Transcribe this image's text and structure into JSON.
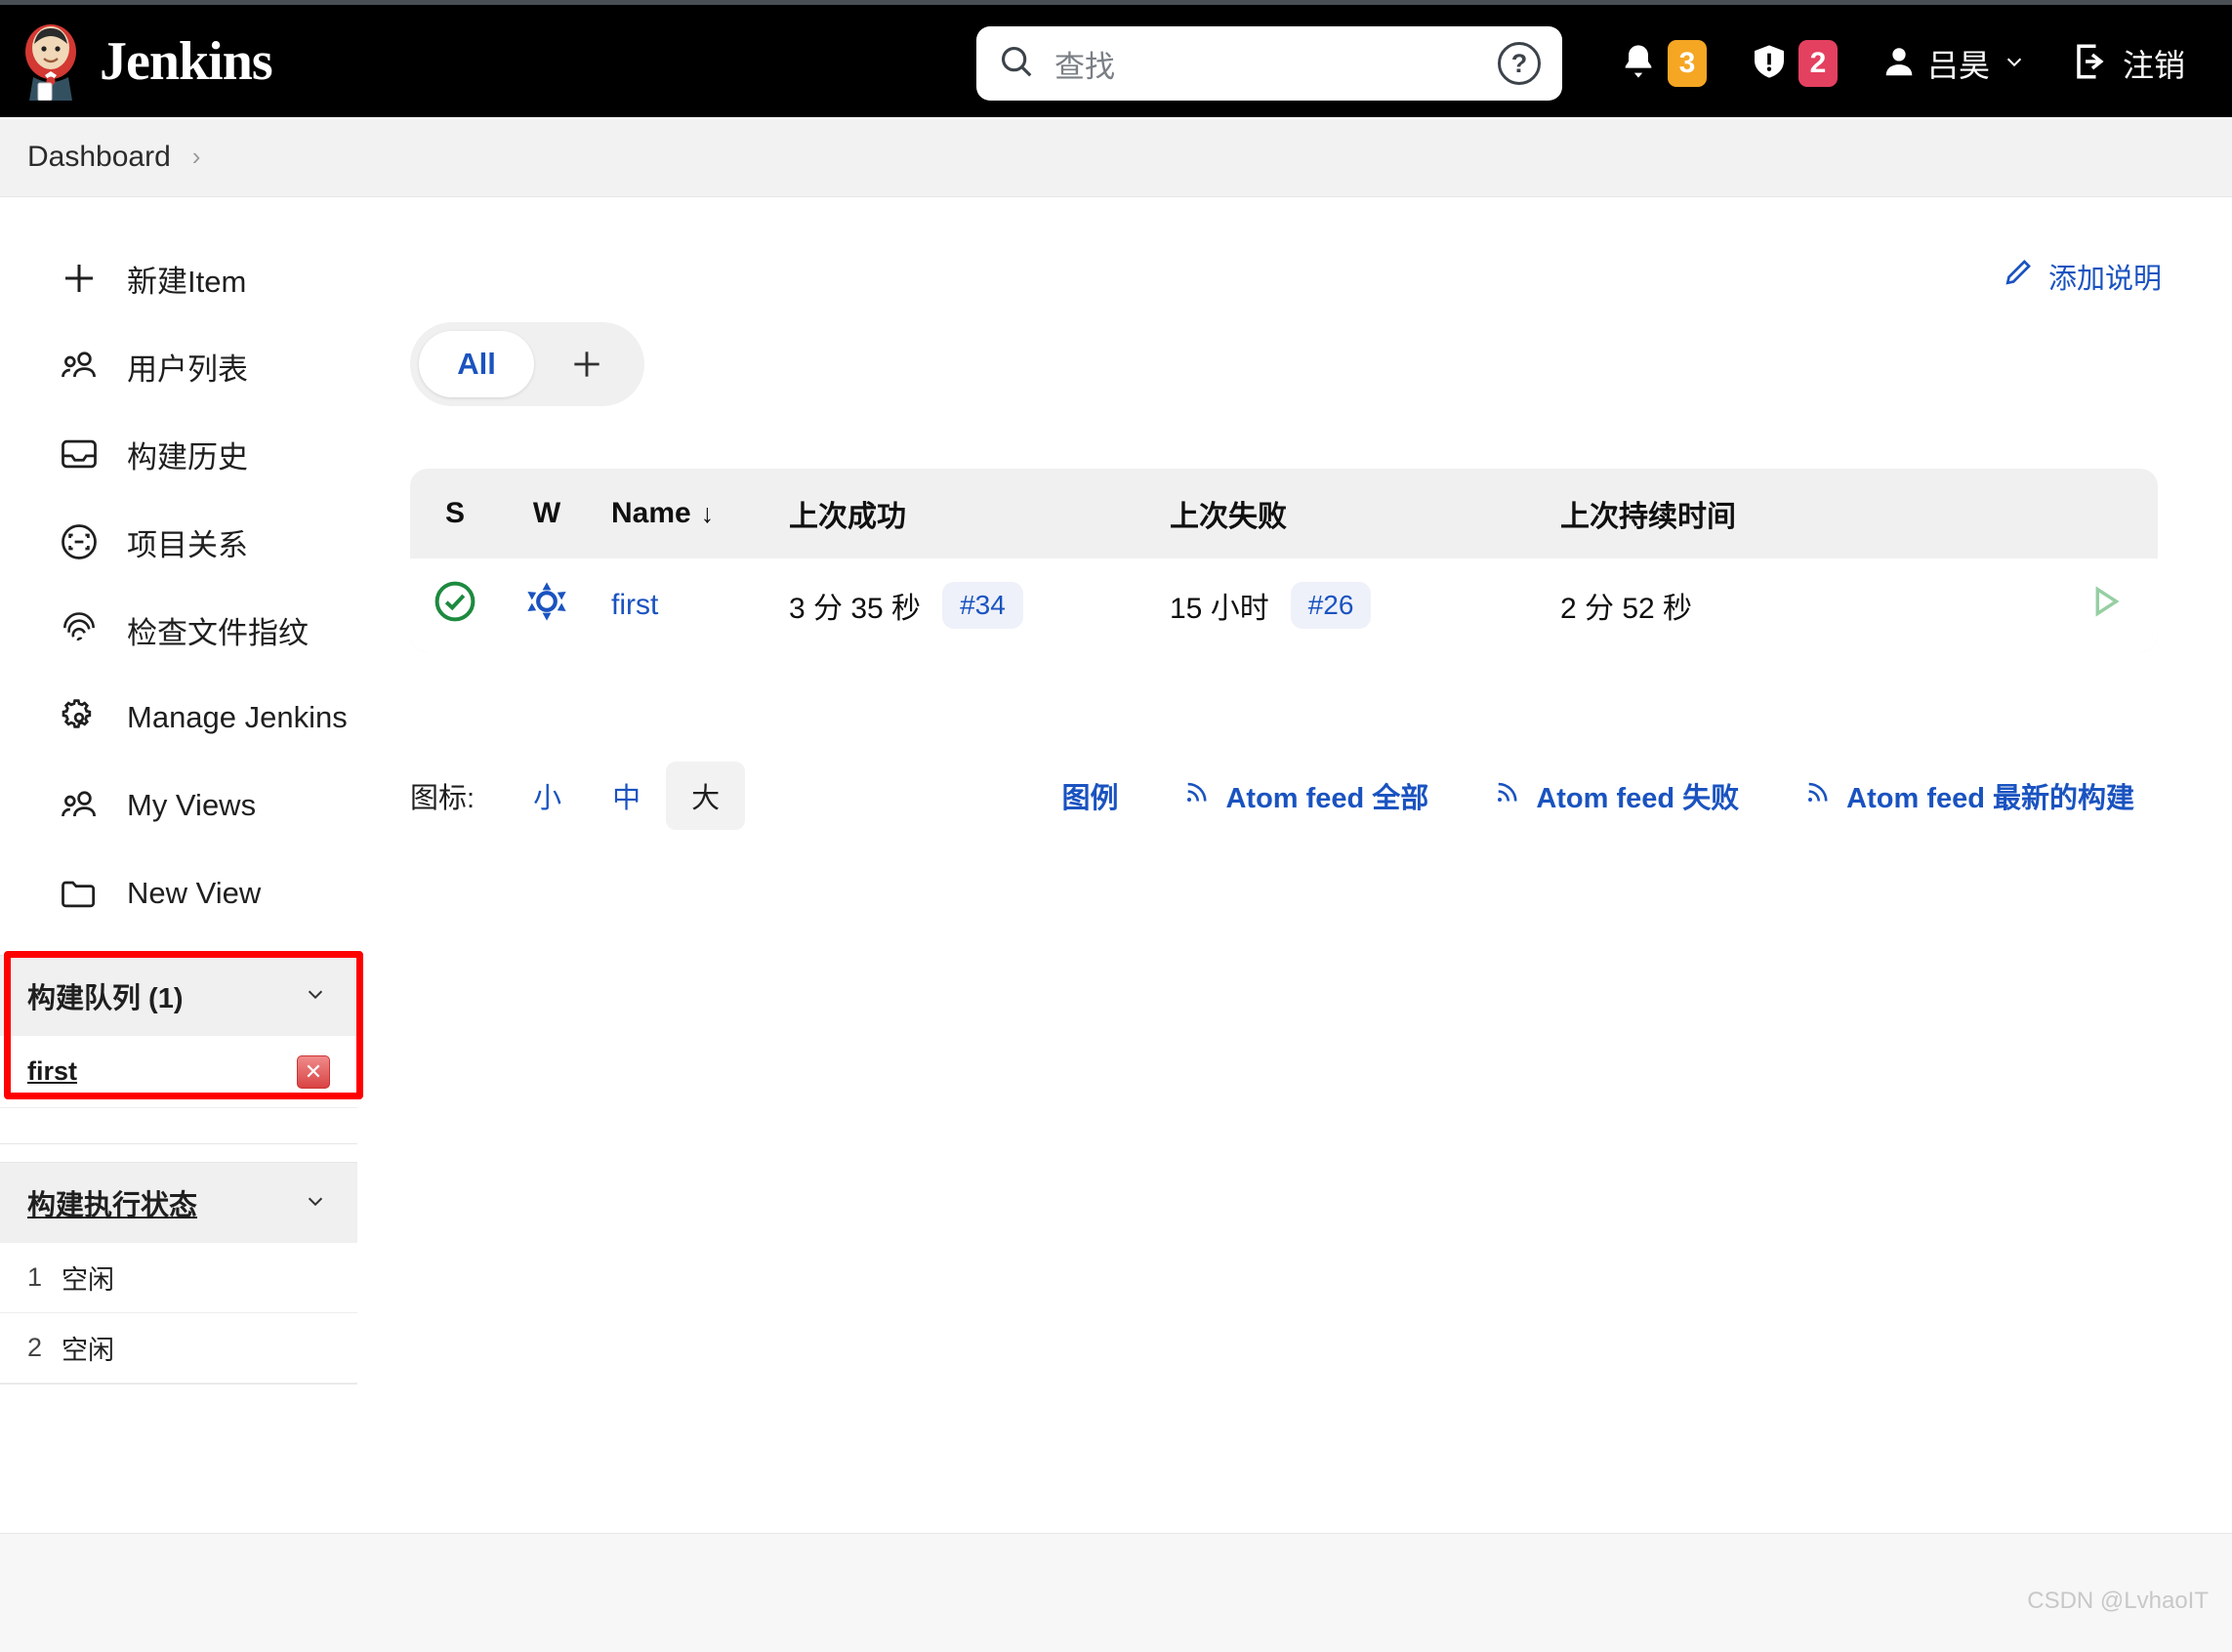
{
  "header": {
    "brand": "Jenkins",
    "search": {
      "placeholder": "查找",
      "help_icon": "help-circle-icon"
    },
    "notifications": {
      "icon": "bell-icon",
      "count": "3",
      "color": "#f5a623"
    },
    "security": {
      "icon": "shield-alert-icon",
      "count": "2",
      "color": "#e4405f"
    },
    "user": {
      "icon": "person-icon",
      "name": "吕昊",
      "chevron": "chevron-down-icon"
    },
    "logout": {
      "icon": "logout-icon",
      "label": "注销"
    }
  },
  "breadcrumb": {
    "items": [
      "Dashboard"
    ],
    "separator": "›"
  },
  "sidebar": {
    "items": [
      {
        "label": "新建Item",
        "icon": "plus-icon"
      },
      {
        "label": "用户列表",
        "icon": "people-icon"
      },
      {
        "label": "构建历史",
        "icon": "inbox-icon"
      },
      {
        "label": "项目关系",
        "icon": "relations-icon"
      },
      {
        "label": "检查文件指纹",
        "icon": "fingerprint-icon"
      },
      {
        "label": "Manage Jenkins",
        "icon": "gear-icon"
      },
      {
        "label": "My Views",
        "icon": "people-icon"
      },
      {
        "label": "New View",
        "icon": "folder-icon"
      }
    ],
    "build_queue": {
      "title": "构建队列 (1)",
      "chevron": "chevron-down-icon",
      "items": [
        {
          "name": "first",
          "cancel_icon": "close-icon"
        }
      ]
    },
    "executor_status": {
      "title": "构建执行状态",
      "chevron": "chevron-down-icon",
      "executors": [
        {
          "num": "1",
          "status": "空闲"
        },
        {
          "num": "2",
          "status": "空闲"
        }
      ]
    }
  },
  "main": {
    "add_description": {
      "label": "添加说明",
      "icon": "pencil-icon"
    },
    "tabs": [
      {
        "label": "All",
        "active": true
      }
    ],
    "tab_add": {
      "icon": "plus-icon"
    },
    "table": {
      "columns": [
        "S",
        "W",
        "Name",
        "上次成功",
        "上次失败",
        "上次持续时间"
      ],
      "sort_column": "Name",
      "sort_arrow": "↓",
      "rows": [
        {
          "status_icon": "success-check-icon",
          "weather_icon": "sunny-icon",
          "name": "first",
          "last_success_time": "3 分 35 秒",
          "last_success_build": "#34",
          "last_failure_time": "15 小时",
          "last_failure_build": "#26",
          "last_duration": "2 分 52 秒",
          "build_action_icon": "play-icon"
        }
      ]
    },
    "icon_size": {
      "label": "图标:",
      "options": [
        {
          "label": "小",
          "active": false
        },
        {
          "label": "中",
          "active": false
        },
        {
          "label": "大",
          "active": true
        }
      ]
    },
    "legend_link": "图例",
    "feeds": [
      {
        "label": "Atom feed 全部",
        "icon": "rss-icon"
      },
      {
        "label": "Atom feed 失败",
        "icon": "rss-icon"
      },
      {
        "label": "Atom feed 最新的构建",
        "icon": "rss-icon"
      }
    ]
  },
  "watermark": "CSDN @LvhaoIT"
}
